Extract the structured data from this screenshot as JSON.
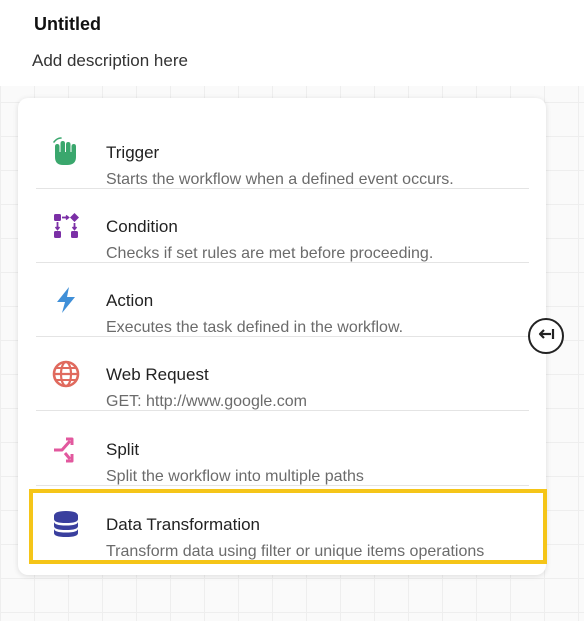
{
  "header": {
    "title": "Untitled",
    "description": "Add description here"
  },
  "menu": {
    "items": [
      {
        "name": "Trigger",
        "description": "Starts the workflow when a defined event occurs.",
        "icon": "hand-tap-icon",
        "color": "#3aa76d"
      },
      {
        "name": "Condition",
        "description": "Checks if set rules are met before proceeding.",
        "icon": "condition-flow-icon",
        "color": "#7b2fa6"
      },
      {
        "name": "Action",
        "description": "Executes the task defined in the workflow.",
        "icon": "lightning-bolt-icon",
        "color": "#3f8fd8"
      },
      {
        "name": "Web Request",
        "description": "GET: http://www.google.com",
        "icon": "globe-icon",
        "color": "#e06a5e"
      },
      {
        "name": "Split",
        "description": "Split the workflow into multiple paths",
        "icon": "split-arrows-icon",
        "color": "#e2589e"
      },
      {
        "name": "Data Transformation",
        "description": "Transform data using filter or unique items operations",
        "icon": "database-icon",
        "color": "#3a3f9e"
      }
    ],
    "selected": "Data Transformation",
    "highlight_color": "#f5c518"
  },
  "collapse_button": {
    "icon": "collapse-left-arrow-icon"
  }
}
